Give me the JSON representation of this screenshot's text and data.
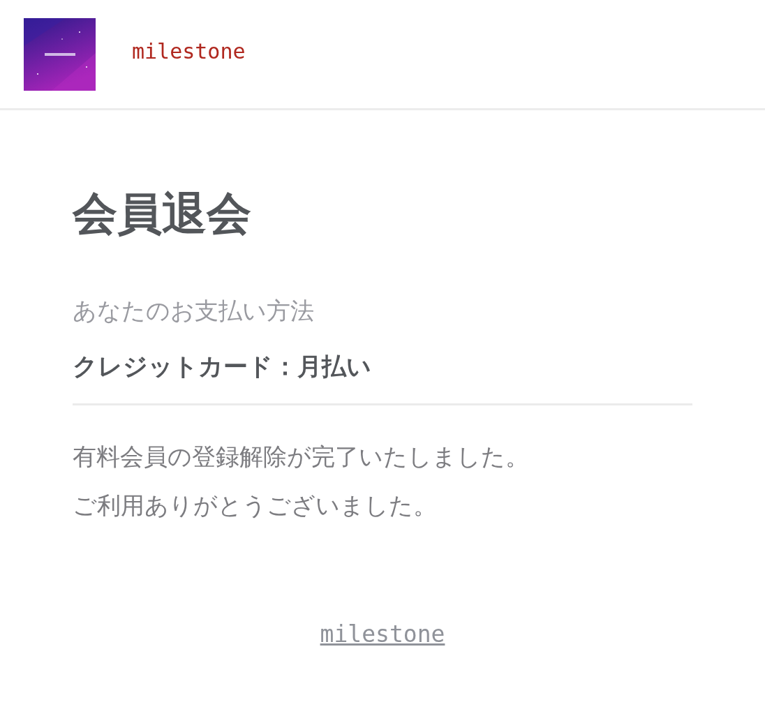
{
  "header": {
    "brand": "milestone"
  },
  "title": "会員退会",
  "payment": {
    "label": "あなたのお支払い方法",
    "value": "クレジットカード：月払い"
  },
  "message": [
    "有料会員の登録解除が完了いたしました。",
    "ご利用ありがとうございました。"
  ],
  "footer": {
    "link": "milestone"
  }
}
